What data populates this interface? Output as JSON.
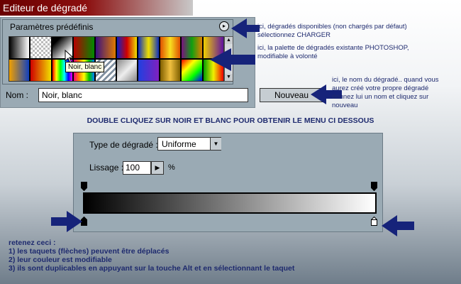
{
  "dialog": {
    "title": "Editeur de dégradé",
    "presets_label": "Paramètres prédéfinis",
    "menu_button": "▸",
    "tooltip": "Noir, blanc",
    "name_label": "Nom :",
    "name_value": "Noir, blanc",
    "new_button": "Nouveau"
  },
  "notes": {
    "menu": [
      "ici, dégradés disponibles (non chargés par défaut)",
      "sélectionnez CHARGER"
    ],
    "palette": [
      "ici, la palette de dégradés existante PHOTOSHOP,",
      "modifiable à volonté"
    ],
    "name": [
      "ici, le nom du dégradé.. quand vous",
      "aurez créé votre propre dégradé",
      "donnez lui un nom et cliquez sur",
      "nouveau"
    ]
  },
  "heading": "DOUBLE CLIQUEZ SUR NOIR ET BLANC POUR OBTENIR LE MENU CI DESSOUS",
  "editor": {
    "type_label": "Type de dégradé :",
    "type_value": "Uniforme",
    "smooth_label": "Lissage :",
    "smooth_value": "100",
    "percent": "%"
  },
  "footer": {
    "title": "retenez ceci :",
    "items": [
      "1) les taquets (flèches) peuvent être déplacés",
      "2) leur couleur est modifiable",
      "3) ils sont duplicables en appuyant sur la touche Alt et en sélectionnant le taquet"
    ]
  },
  "colors": {
    "title_bar": "#8c1010",
    "panel": "#9aaab4",
    "annotation_text": "#1e2a6e",
    "arrow": "#16237a"
  },
  "icons": {
    "menu": "play-circle-icon",
    "cursor": "arrow-cursor-icon",
    "pointer_arrow": "big-arrow-icon"
  }
}
